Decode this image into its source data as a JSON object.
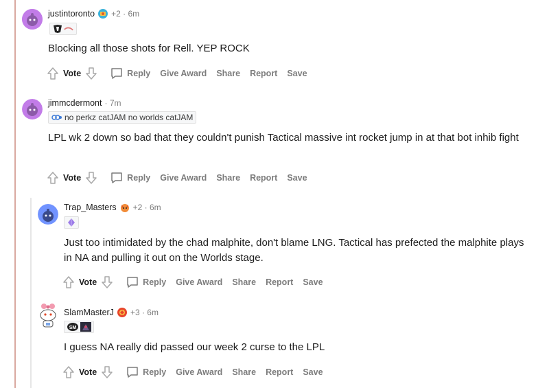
{
  "comments": [
    {
      "author": "justintoronto",
      "meta": "+2 · 6m",
      "flair_text": "",
      "body": "Blocking all those shots for Rell. YEP ROCK",
      "avatar_color": "#c27ce8"
    },
    {
      "author": "jimmcdermont",
      "meta": "· 7m",
      "flair_text": "no perkz catJAM no worlds catJAM",
      "body": "LPL wk 2 down so bad that they couldn't punish Tactical massive int rocket jump in at that bot inhib fight",
      "avatar_color": "#c27ce8"
    },
    {
      "author": "Trap_Masters",
      "meta": "+2 · 6m",
      "flair_text": "",
      "body": "Just too intimidated by the chad malphite, don't blame LNG. Tactical has prefected the malphite plays in NA and pulling it out on the Worlds stage.",
      "avatar_color": "#7193ff"
    },
    {
      "author": "SlamMasterJ",
      "meta": "+3 · 6m",
      "flair_text": "",
      "body": "I guess NA really did passed our week 2 curse to the LPL",
      "avatar_color": "#ffffff"
    }
  ],
  "actions": {
    "vote": "Vote",
    "reply": "Reply",
    "give_award": "Give Award",
    "share": "Share",
    "report": "Report",
    "save": "Save"
  },
  "colors": {
    "thread_line": "#d9a8a0",
    "muted": "#7c7c7c",
    "text": "#1c1c1c"
  }
}
